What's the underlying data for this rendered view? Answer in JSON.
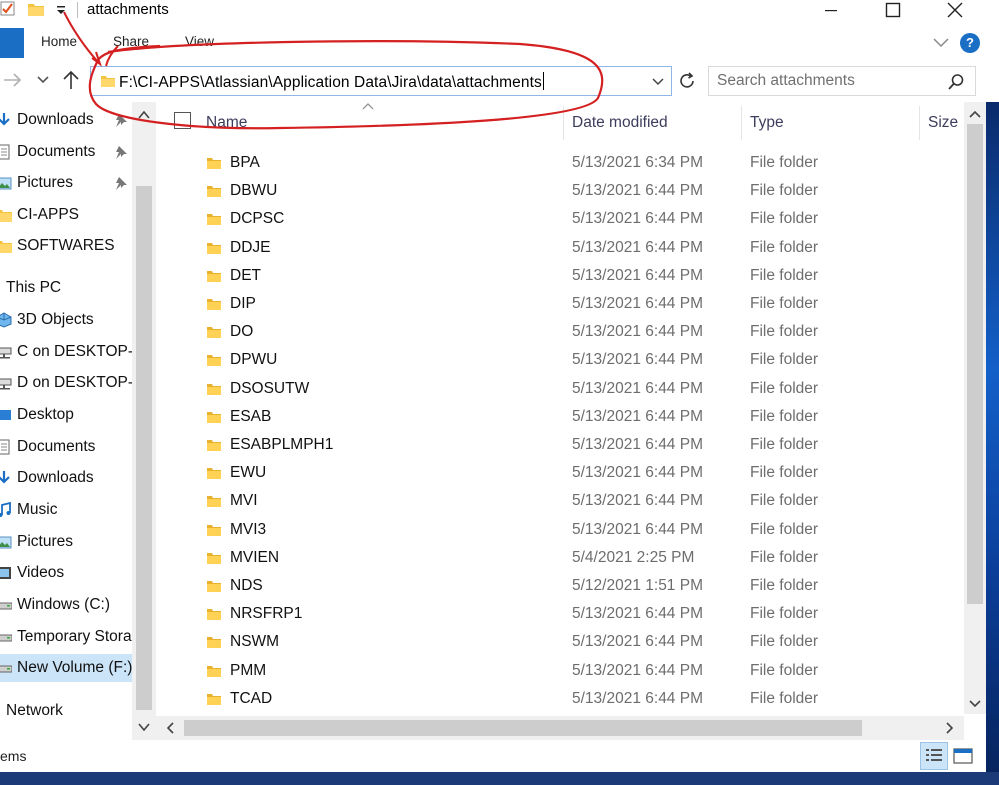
{
  "window": {
    "title": "attachments",
    "qa_icons": [
      "checkmark-properties-icon",
      "new-folder-icon",
      "customize-dropdown-icon"
    ],
    "controls": [
      "minimize-icon",
      "maximize-icon",
      "close-icon"
    ]
  },
  "ribbon": {
    "tabs": [
      {
        "label": "Home"
      },
      {
        "label": "Share"
      },
      {
        "label": "View"
      }
    ],
    "accent_color": "#1a6fc4",
    "help_label": "?"
  },
  "address": {
    "path": "F:\\CI-APPS\\Atlassian\\Application Data\\Jira\\data\\attachments",
    "search_placeholder": "Search attachments"
  },
  "sidebar": {
    "items": [
      {
        "label": "Downloads",
        "icon": "download-arrow-icon",
        "pinned": true
      },
      {
        "label": "Documents",
        "icon": "document-icon",
        "pinned": true
      },
      {
        "label": "Pictures",
        "icon": "pictures-icon",
        "pinned": true
      },
      {
        "label": "CI-APPS",
        "icon": "folder-icon",
        "pinned": false
      },
      {
        "label": "SOFTWARES",
        "icon": "folder-icon",
        "pinned": false
      },
      {
        "label": "This PC",
        "icon": "computer-icon",
        "pinned": false
      },
      {
        "label": "3D Objects",
        "icon": "3d-objects-icon",
        "pinned": false
      },
      {
        "label": "C on DESKTOP-J",
        "icon": "network-drive-icon",
        "pinned": false
      },
      {
        "label": "D on DESKTOP-J",
        "icon": "network-drive-icon",
        "pinned": false
      },
      {
        "label": "Desktop",
        "icon": "desktop-icon",
        "pinned": false
      },
      {
        "label": "Documents",
        "icon": "document-icon",
        "pinned": false
      },
      {
        "label": "Downloads",
        "icon": "download-arrow-icon",
        "pinned": false
      },
      {
        "label": "Music",
        "icon": "music-icon",
        "pinned": false
      },
      {
        "label": "Pictures",
        "icon": "pictures-icon",
        "pinned": false
      },
      {
        "label": "Videos",
        "icon": "videos-icon",
        "pinned": false
      },
      {
        "label": "Windows (C:)",
        "icon": "drive-icon",
        "pinned": false
      },
      {
        "label": "Temporary Stora",
        "icon": "drive-icon",
        "pinned": false
      },
      {
        "label": "New Volume (F:)",
        "icon": "drive-icon",
        "pinned": false,
        "selected": true
      },
      {
        "label": "Network",
        "icon": "network-icon",
        "pinned": false
      }
    ]
  },
  "columns": {
    "name": "Name",
    "date": "Date modified",
    "type": "Type",
    "size": "Size"
  },
  "files": [
    {
      "name": "BPA",
      "date": "5/13/2021 6:34 PM",
      "type": "File folder"
    },
    {
      "name": "DBWU",
      "date": "5/13/2021 6:44 PM",
      "type": "File folder"
    },
    {
      "name": "DCPSC",
      "date": "5/13/2021 6:44 PM",
      "type": "File folder"
    },
    {
      "name": "DDJE",
      "date": "5/13/2021 6:44 PM",
      "type": "File folder"
    },
    {
      "name": "DET",
      "date": "5/13/2021 6:44 PM",
      "type": "File folder"
    },
    {
      "name": "DIP",
      "date": "5/13/2021 6:44 PM",
      "type": "File folder"
    },
    {
      "name": "DO",
      "date": "5/13/2021 6:44 PM",
      "type": "File folder"
    },
    {
      "name": "DPWU",
      "date": "5/13/2021 6:44 PM",
      "type": "File folder"
    },
    {
      "name": "DSOSUTW",
      "date": "5/13/2021 6:44 PM",
      "type": "File folder"
    },
    {
      "name": "ESAB",
      "date": "5/13/2021 6:44 PM",
      "type": "File folder"
    },
    {
      "name": "ESABPLMPH1",
      "date": "5/13/2021 6:44 PM",
      "type": "File folder"
    },
    {
      "name": "EWU",
      "date": "5/13/2021 6:44 PM",
      "type": "File folder"
    },
    {
      "name": "MVI",
      "date": "5/13/2021 6:44 PM",
      "type": "File folder"
    },
    {
      "name": "MVI3",
      "date": "5/13/2021 6:44 PM",
      "type": "File folder"
    },
    {
      "name": "MVIEN",
      "date": "5/4/2021 2:25 PM",
      "type": "File folder"
    },
    {
      "name": "NDS",
      "date": "5/12/2021 1:51 PM",
      "type": "File folder"
    },
    {
      "name": "NRSFRP1",
      "date": "5/13/2021 6:44 PM",
      "type": "File folder"
    },
    {
      "name": "NSWM",
      "date": "5/13/2021 6:44 PM",
      "type": "File folder"
    },
    {
      "name": "PMM",
      "date": "5/13/2021 6:44 PM",
      "type": "File folder"
    },
    {
      "name": "TCAD",
      "date": "5/13/2021 6:44 PM",
      "type": "File folder"
    }
  ],
  "status": {
    "text": "ems",
    "view_icons": [
      "details-view-icon",
      "large-icons-view-icon"
    ]
  },
  "annotation": {
    "color": "#d42020",
    "description_icon": "red-hand-drawn-circle-annotation"
  }
}
